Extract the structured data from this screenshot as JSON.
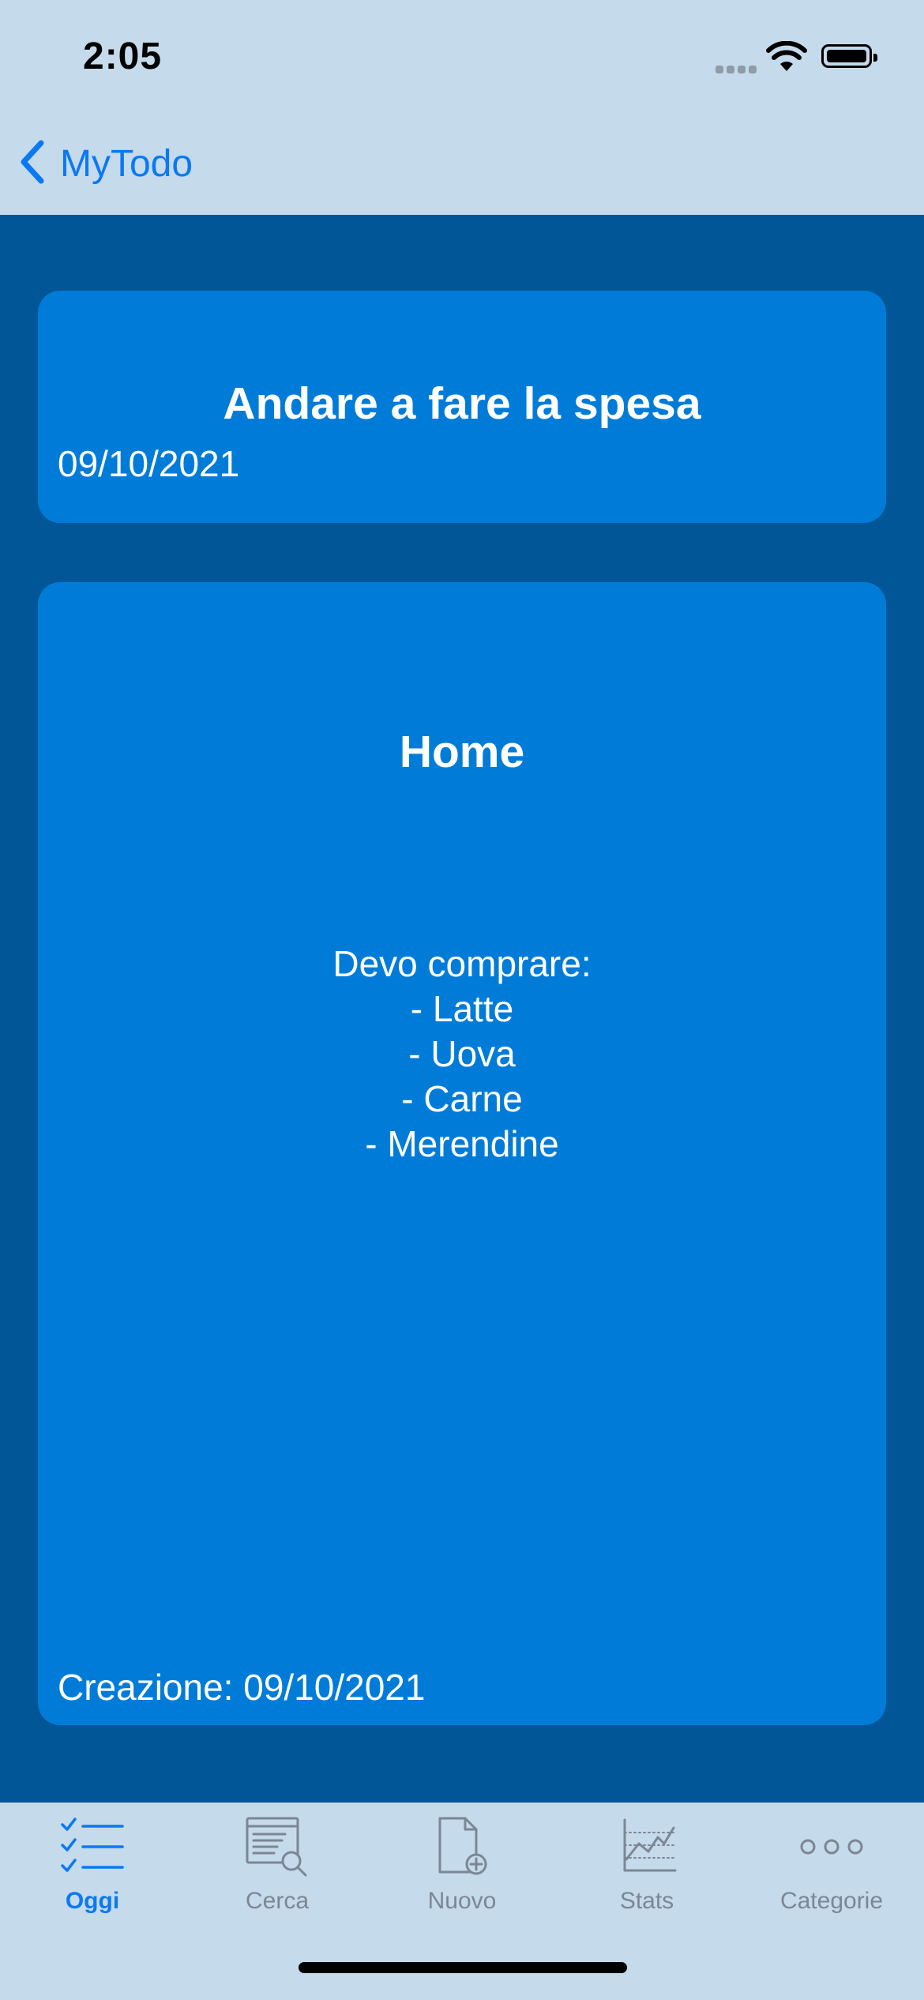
{
  "status_bar": {
    "time": "2:05"
  },
  "nav": {
    "back_label": "MyTodo"
  },
  "todo": {
    "title": "Andare a fare la spesa",
    "date": "09/10/2021",
    "category": "Home",
    "body_lines": [
      "Devo comprare:",
      "- Latte",
      "- Uova",
      "- Carne",
      "- Merendine"
    ],
    "created": "Creazione: 09/10/2021"
  },
  "tabs": [
    {
      "label": "Oggi",
      "icon": "checklist-icon",
      "active": true
    },
    {
      "label": "Cerca",
      "icon": "document-search-icon",
      "active": false
    },
    {
      "label": "Nuovo",
      "icon": "document-add-icon",
      "active": false
    },
    {
      "label": "Stats",
      "icon": "chart-icon",
      "active": false
    },
    {
      "label": "Categorie",
      "icon": "more-icon",
      "active": false
    }
  ],
  "colors": {
    "bar_background": "#c5daea",
    "content_background": "#005696",
    "card_background": "#007cd8",
    "accent": "#0a79f4",
    "inactive_tab": "#7b8794"
  }
}
